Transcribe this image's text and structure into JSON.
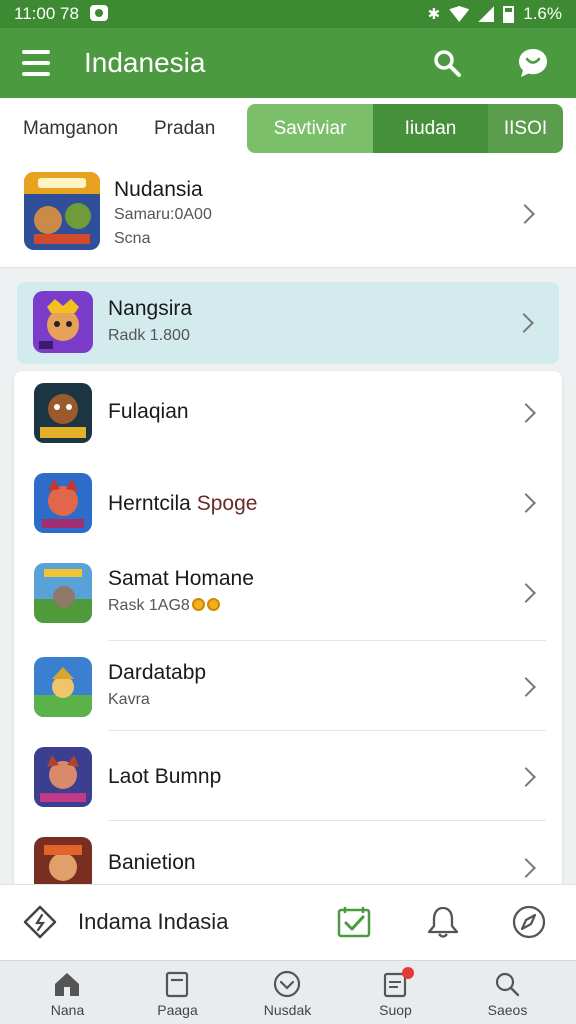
{
  "status_bar": {
    "time": "11:00 78",
    "battery": "1.6%"
  },
  "app_bar": {
    "title": "Indanesia"
  },
  "tabs": {
    "plain": [
      "Mamganon",
      "Pradan"
    ],
    "segmented": [
      "Savtiviar",
      "Iiudan",
      "IISOI"
    ]
  },
  "featured": {
    "title": "Nudansia",
    "line1": "Samaru:0A00",
    "line2": "Scna"
  },
  "highlighted": {
    "title": "Nangsira",
    "subtitle": "Radk 1.800"
  },
  "list": [
    {
      "title": "Fulaqian",
      "subtitle": ""
    },
    {
      "title": "Herntcila",
      "title_suffix": "Spoge",
      "subtitle": ""
    },
    {
      "title": "Samat Homane",
      "subtitle": "Rask 1AG8"
    },
    {
      "title": "Dardatabp",
      "subtitle": "Kavra"
    },
    {
      "title": "Laot Bumnp",
      "subtitle": ""
    },
    {
      "title": "Banietion",
      "subtitle": ""
    }
  ],
  "action_bar": {
    "label": "Indama Indasia"
  },
  "bottom_nav": [
    "Nana",
    "Paaga",
    "Nusdak",
    "Suop",
    "Saeos"
  ],
  "colors": {
    "primary": "#4b9a40",
    "status": "#3d8a33",
    "highlight": "#d4ebee",
    "badge": "#e53935"
  },
  "icons": [
    "menu-icon",
    "search-icon",
    "chat-icon",
    "chevron-right-icon",
    "diamond-nav-icon",
    "checkbox-icon",
    "bell-icon",
    "compass-icon",
    "home-icon",
    "bag-icon",
    "download-icon",
    "note-icon",
    "search-nav-icon"
  ]
}
